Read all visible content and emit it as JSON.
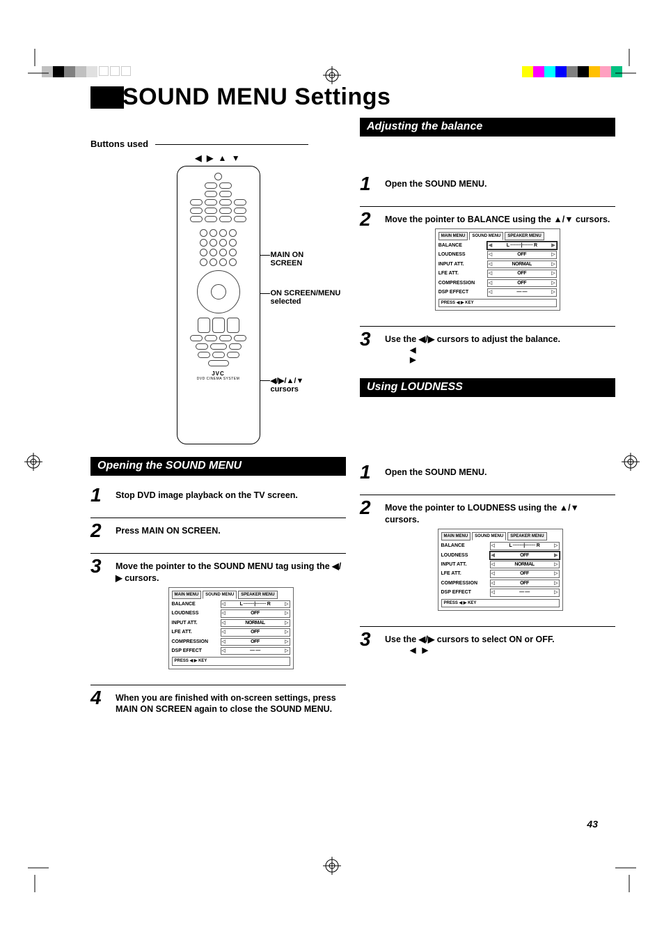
{
  "page_number": "43",
  "title": "SOUND MENU Settings",
  "buttons_used_label": "Buttons used",
  "cursor_legend": "◀ ▶ ▲ ▼",
  "remote": {
    "brand": "JVC",
    "subtitle": "DVD CINEMA SYSTEM",
    "callouts": {
      "main_on_screen": "MAIN ON SCREEN",
      "on_screen_menu": "ON SCREEN/MENU selected",
      "cursors_label": "◀/▶/▲/▼ cursors"
    }
  },
  "sections": {
    "opening": {
      "bar": "Opening the SOUND MENU",
      "steps": [
        {
          "n": "1",
          "text": "Stop DVD image playback on the TV screen."
        },
        {
          "n": "2",
          "text": "Press MAIN ON SCREEN."
        },
        {
          "n": "3",
          "text": "Move the pointer to the SOUND MENU tag using the ◀/▶ cursors."
        },
        {
          "n": "4",
          "text": "When you are finished with on-screen settings, press MAIN ON SCREEN again to close the SOUND MENU."
        }
      ]
    },
    "balance": {
      "bar": "Adjusting the balance",
      "steps": [
        {
          "n": "1",
          "text": "Open the SOUND MENU."
        },
        {
          "n": "2",
          "text": "Move the pointer to BALANCE using the ▲/▼ cursors."
        },
        {
          "n": "3",
          "text": "Use the ◀/▶ cursors to adjust the balance."
        }
      ]
    },
    "loudness": {
      "bar": "Using LOUDNESS",
      "steps": [
        {
          "n": "1",
          "text": "Open the SOUND MENU."
        },
        {
          "n": "2",
          "text": "Move the pointer to LOUDNESS using the ▲/▼ cursors."
        },
        {
          "n": "3",
          "text": "Use the ◀/▶ cursors to select ON or OFF."
        }
      ]
    }
  },
  "sound_menu_graphic": {
    "tabs": [
      "MAIN MENU",
      "SOUND MENU",
      "SPEAKER MENU"
    ],
    "rows": [
      {
        "label": "BALANCE",
        "value": "L ········|········ R"
      },
      {
        "label": "LOUDNESS",
        "value": "OFF"
      },
      {
        "label": "INPUT ATT.",
        "value": "NORMAL"
      },
      {
        "label": "LFE ATT.",
        "value": "OFF"
      },
      {
        "label": "COMPRESSION",
        "value": "OFF"
      },
      {
        "label": "DSP EFFECT",
        "value": "— —"
      }
    ],
    "footer": "PRESS ◀ ▶ KEY"
  },
  "glyphs": {
    "lr": "◀ ▶",
    "lr2": "◀  \n▶"
  },
  "reg_colors_left": [
    "#c0c0c0",
    "#000000",
    "#808080",
    "#c0c0c0",
    "#e0e0e0"
  ],
  "reg_colors_right": [
    "#ffff00",
    "#ff00ff",
    "#00ffff",
    "#0000ff",
    "#808080",
    "#000000",
    "#ffc000",
    "#ffa0c0",
    "#00c080"
  ]
}
